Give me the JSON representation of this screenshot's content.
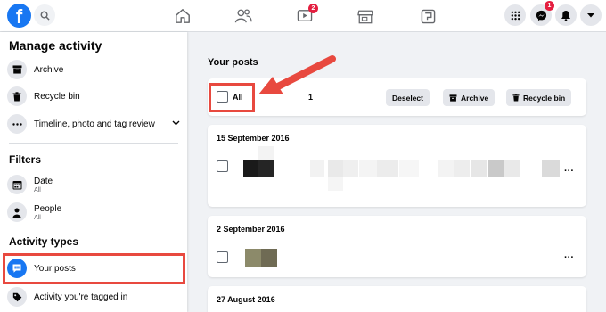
{
  "topbar": {
    "logo": "f",
    "nav_icons": [
      "home-icon",
      "friends-icon",
      "watch-icon",
      "marketplace-icon",
      "groups-icon"
    ],
    "watch_badge": "2",
    "messenger_badge": "1",
    "right_icons": [
      "menu-grid-icon",
      "messenger-icon",
      "notifications-icon",
      "account-dropdown-icon"
    ]
  },
  "sidebar": {
    "title": "Manage activity",
    "items": [
      {
        "label": "Archive",
        "icon": "archive-icon"
      },
      {
        "label": "Recycle bin",
        "icon": "trash-icon"
      },
      {
        "label": "Timeline, photo and tag review",
        "icon": "more-icon"
      }
    ],
    "filters_title": "Filters",
    "filters": [
      {
        "label": "Date",
        "sub": "All",
        "icon": "calendar-icon"
      },
      {
        "label": "People",
        "sub": "All",
        "icon": "person-icon"
      }
    ],
    "activity_title": "Activity types",
    "activity_items": [
      {
        "label": "Your posts",
        "icon": "posts-icon"
      },
      {
        "label": "Activity you're tagged in",
        "icon": "tag-icon"
      }
    ]
  },
  "main": {
    "heading": "Your posts",
    "toolbar": {
      "all_label": "All",
      "count": "1",
      "deselect_label": "Deselect",
      "archive_label": "Archive",
      "recycle_label": "Recycle bin"
    },
    "groups": [
      {
        "date": "15 September 2016"
      },
      {
        "date": "2 September 2016"
      },
      {
        "date": "27 August 2016"
      }
    ],
    "more_label": "···"
  },
  "colors": {
    "accent": "#1877f2",
    "highlight": "#e8493f",
    "badge": "#e41e3f",
    "background": "#f0f2f5"
  }
}
